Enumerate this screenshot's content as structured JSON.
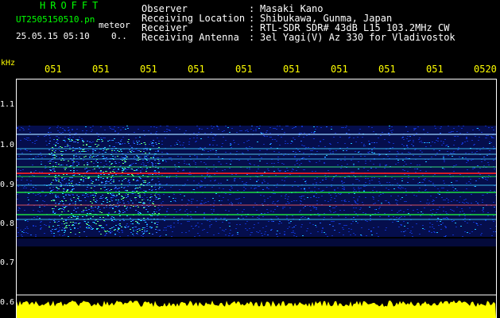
{
  "header": {
    "app_title": "HROFFT",
    "file_name": "UT2505150510.pn",
    "meteor_label": "meteor",
    "date_time": "25.05.15 05:10",
    "date_extra": "0.."
  },
  "station_info": [
    {
      "label": "Observer",
      "value": "Masaki Kano"
    },
    {
      "label": "Receiving Location",
      "value": "Shibukawa, Gunma, Japan"
    },
    {
      "label": "Receiver",
      "value": "RTL-SDR SDR# 43dB L15 103.2MHz CW"
    },
    {
      "label": "Receiving Antenna",
      "value": "3el Yagi(V) Az 330 for Vladivostok"
    }
  ],
  "axis": {
    "freq_unit": "kHz",
    "time_ticks": [
      "051",
      "051",
      "051",
      "051",
      "051",
      "051",
      "051",
      "051",
      "051",
      "0520"
    ],
    "freq_ticks": [
      "1.1",
      "1.0",
      "0.9",
      "0.8",
      "0.7",
      "0.6"
    ]
  },
  "colors": {
    "text_green": "#00ff00",
    "text_white": "#ffffff",
    "text_yellow": "#ffff00",
    "background": "#000000",
    "noise_band": "#0a1a8a",
    "signal_red": "#ff2020",
    "signal_green": "#20ff40",
    "signal_cyan": "#20d0ff",
    "amplitude_yellow": "#ffff00"
  }
}
